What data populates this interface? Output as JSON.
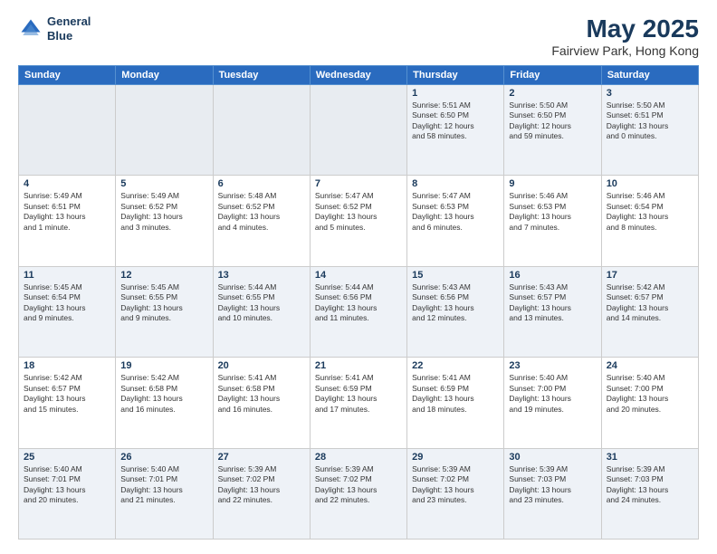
{
  "header": {
    "logo_line1": "General",
    "logo_line2": "Blue",
    "title": "May 2025",
    "subtitle": "Fairview Park, Hong Kong"
  },
  "days": [
    "Sunday",
    "Monday",
    "Tuesday",
    "Wednesday",
    "Thursday",
    "Friday",
    "Saturday"
  ],
  "weeks": [
    [
      {
        "day": "",
        "info": ""
      },
      {
        "day": "",
        "info": ""
      },
      {
        "day": "",
        "info": ""
      },
      {
        "day": "",
        "info": ""
      },
      {
        "day": "1",
        "info": "Sunrise: 5:51 AM\nSunset: 6:50 PM\nDaylight: 12 hours\nand 58 minutes."
      },
      {
        "day": "2",
        "info": "Sunrise: 5:50 AM\nSunset: 6:50 PM\nDaylight: 12 hours\nand 59 minutes."
      },
      {
        "day": "3",
        "info": "Sunrise: 5:50 AM\nSunset: 6:51 PM\nDaylight: 13 hours\nand 0 minutes."
      }
    ],
    [
      {
        "day": "4",
        "info": "Sunrise: 5:49 AM\nSunset: 6:51 PM\nDaylight: 13 hours\nand 1 minute."
      },
      {
        "day": "5",
        "info": "Sunrise: 5:49 AM\nSunset: 6:52 PM\nDaylight: 13 hours\nand 3 minutes."
      },
      {
        "day": "6",
        "info": "Sunrise: 5:48 AM\nSunset: 6:52 PM\nDaylight: 13 hours\nand 4 minutes."
      },
      {
        "day": "7",
        "info": "Sunrise: 5:47 AM\nSunset: 6:52 PM\nDaylight: 13 hours\nand 5 minutes."
      },
      {
        "day": "8",
        "info": "Sunrise: 5:47 AM\nSunset: 6:53 PM\nDaylight: 13 hours\nand 6 minutes."
      },
      {
        "day": "9",
        "info": "Sunrise: 5:46 AM\nSunset: 6:53 PM\nDaylight: 13 hours\nand 7 minutes."
      },
      {
        "day": "10",
        "info": "Sunrise: 5:46 AM\nSunset: 6:54 PM\nDaylight: 13 hours\nand 8 minutes."
      }
    ],
    [
      {
        "day": "11",
        "info": "Sunrise: 5:45 AM\nSunset: 6:54 PM\nDaylight: 13 hours\nand 9 minutes."
      },
      {
        "day": "12",
        "info": "Sunrise: 5:45 AM\nSunset: 6:55 PM\nDaylight: 13 hours\nand 9 minutes."
      },
      {
        "day": "13",
        "info": "Sunrise: 5:44 AM\nSunset: 6:55 PM\nDaylight: 13 hours\nand 10 minutes."
      },
      {
        "day": "14",
        "info": "Sunrise: 5:44 AM\nSunset: 6:56 PM\nDaylight: 13 hours\nand 11 minutes."
      },
      {
        "day": "15",
        "info": "Sunrise: 5:43 AM\nSunset: 6:56 PM\nDaylight: 13 hours\nand 12 minutes."
      },
      {
        "day": "16",
        "info": "Sunrise: 5:43 AM\nSunset: 6:57 PM\nDaylight: 13 hours\nand 13 minutes."
      },
      {
        "day": "17",
        "info": "Sunrise: 5:42 AM\nSunset: 6:57 PM\nDaylight: 13 hours\nand 14 minutes."
      }
    ],
    [
      {
        "day": "18",
        "info": "Sunrise: 5:42 AM\nSunset: 6:57 PM\nDaylight: 13 hours\nand 15 minutes."
      },
      {
        "day": "19",
        "info": "Sunrise: 5:42 AM\nSunset: 6:58 PM\nDaylight: 13 hours\nand 16 minutes."
      },
      {
        "day": "20",
        "info": "Sunrise: 5:41 AM\nSunset: 6:58 PM\nDaylight: 13 hours\nand 16 minutes."
      },
      {
        "day": "21",
        "info": "Sunrise: 5:41 AM\nSunset: 6:59 PM\nDaylight: 13 hours\nand 17 minutes."
      },
      {
        "day": "22",
        "info": "Sunrise: 5:41 AM\nSunset: 6:59 PM\nDaylight: 13 hours\nand 18 minutes."
      },
      {
        "day": "23",
        "info": "Sunrise: 5:40 AM\nSunset: 7:00 PM\nDaylight: 13 hours\nand 19 minutes."
      },
      {
        "day": "24",
        "info": "Sunrise: 5:40 AM\nSunset: 7:00 PM\nDaylight: 13 hours\nand 20 minutes."
      }
    ],
    [
      {
        "day": "25",
        "info": "Sunrise: 5:40 AM\nSunset: 7:01 PM\nDaylight: 13 hours\nand 20 minutes."
      },
      {
        "day": "26",
        "info": "Sunrise: 5:40 AM\nSunset: 7:01 PM\nDaylight: 13 hours\nand 21 minutes."
      },
      {
        "day": "27",
        "info": "Sunrise: 5:39 AM\nSunset: 7:02 PM\nDaylight: 13 hours\nand 22 minutes."
      },
      {
        "day": "28",
        "info": "Sunrise: 5:39 AM\nSunset: 7:02 PM\nDaylight: 13 hours\nand 22 minutes."
      },
      {
        "day": "29",
        "info": "Sunrise: 5:39 AM\nSunset: 7:02 PM\nDaylight: 13 hours\nand 23 minutes."
      },
      {
        "day": "30",
        "info": "Sunrise: 5:39 AM\nSunset: 7:03 PM\nDaylight: 13 hours\nand 23 minutes."
      },
      {
        "day": "31",
        "info": "Sunrise: 5:39 AM\nSunset: 7:03 PM\nDaylight: 13 hours\nand 24 minutes."
      }
    ]
  ]
}
